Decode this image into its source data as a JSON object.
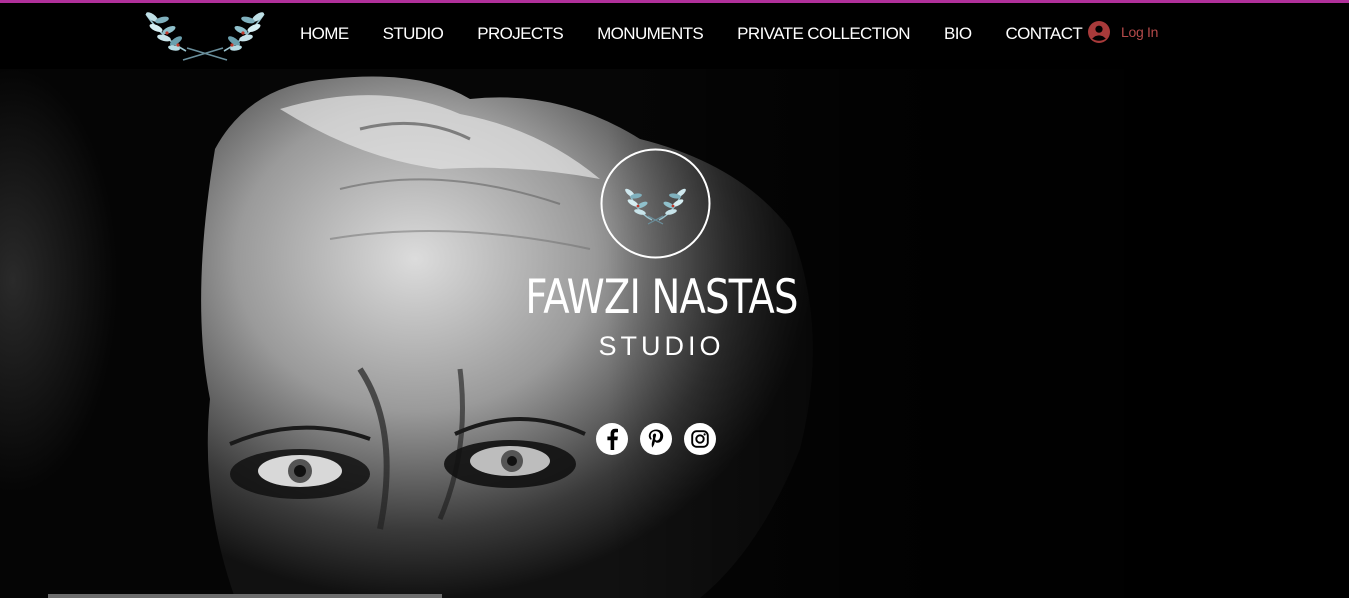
{
  "header": {
    "logo_icon": "laurel-wreath-icon",
    "nav": [
      "HOME",
      "STUDIO",
      "PROJECTS",
      "MONUMENTS",
      "PRIVATE COLLECTION",
      "BIO",
      "CONTACT"
    ],
    "login_label": "Log In",
    "login_icon": "user-avatar-icon"
  },
  "hero": {
    "emblem_icon": "laurel-wreath-icon",
    "title": "FAWZI NASTAS",
    "subtitle": "STUDIO",
    "social": [
      "facebook-icon",
      "pinterest-icon",
      "instagram-icon"
    ]
  },
  "colors": {
    "accent_line": "#b0309a",
    "login_text": "#b54a4a",
    "background": "#000000"
  }
}
